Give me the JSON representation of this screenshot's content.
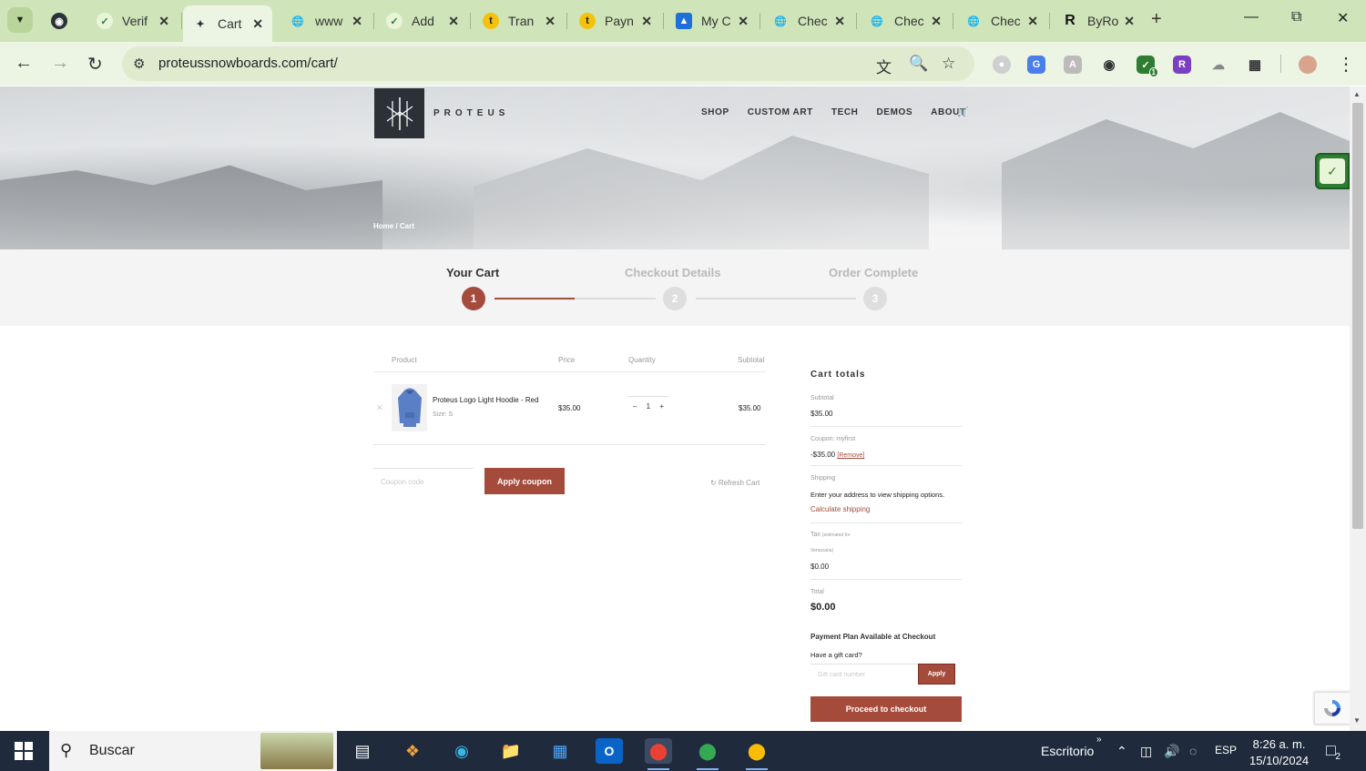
{
  "browser": {
    "tabs": [
      {
        "label": "Verif",
        "icon": "verify-icon",
        "color": "#2e7d32"
      },
      {
        "label": "Cart",
        "icon": "proteus-icon",
        "color": "#2b3137",
        "active": true
      },
      {
        "label": "www",
        "icon": "globe-icon",
        "color": "#333"
      },
      {
        "label": "Add",
        "icon": "verify-icon",
        "color": "#2e7d32"
      },
      {
        "label": "Tran",
        "icon": "t-icon",
        "color": "#f4c20d"
      },
      {
        "label": "Payn",
        "icon": "t-icon",
        "color": "#f4c20d"
      },
      {
        "label": "My C",
        "icon": "edge-icon",
        "color": "#1e6fd9"
      },
      {
        "label": "Chec",
        "icon": "globe-icon",
        "color": "#333"
      },
      {
        "label": "Chec",
        "icon": "globe-icon",
        "color": "#333"
      },
      {
        "label": "Chec",
        "icon": "globe-icon",
        "color": "#333"
      },
      {
        "label": "ByRo",
        "icon": "r-icon",
        "color": "#111"
      }
    ],
    "url": "proteussnowboards.com/cart/",
    "extension_badge": "1"
  },
  "site": {
    "logo_text": "PROTEUS",
    "nav": [
      "SHOP",
      "CUSTOM ART",
      "TECH",
      "DEMOS",
      "ABOUT"
    ],
    "breadcrumb": "Home  /  Cart"
  },
  "steps": [
    {
      "label": "Your Cart",
      "number": "1",
      "active": true
    },
    {
      "label": "Checkout Details",
      "number": "2",
      "active": false
    },
    {
      "label": "Order Complete",
      "number": "3",
      "active": false
    }
  ],
  "cart": {
    "headers": {
      "product": "Product",
      "price": "Price",
      "quantity": "Quantity",
      "subtotal": "Subtotal"
    },
    "item": {
      "name": "Proteus Logo Light Hoodie - Red",
      "meta": "Size: S",
      "price": "$35.00",
      "quantity": "1",
      "subtotal": "$35.00"
    },
    "coupon_placeholder": "Coupon code",
    "apply_coupon": "Apply coupon",
    "refresh": "Refresh Cart"
  },
  "totals": {
    "title": "Cart totals",
    "subtotal_label": "Subtotal",
    "subtotal_value": "$35.00",
    "coupon_label": "Coupon: myfirst",
    "coupon_value": "-$35.00",
    "coupon_remove": "[Remove]",
    "shipping_label": "Shipping",
    "shipping_text": "Enter your address to view shipping options.",
    "shipping_link": "Calculate shipping",
    "tax_label": "Tax",
    "tax_note": "(estimated for",
    "tax_country": "Venezuela)",
    "tax_value": "$0.00",
    "total_label": "Total",
    "total_value": "$0.00",
    "payment_plan": "Payment Plan Available at Checkout",
    "gift_label": "Have a gift card?",
    "gift_placeholder": "Gift card number",
    "gift_apply": "Apply",
    "checkout": "Proceed to checkout"
  },
  "taskbar": {
    "search": "Buscar",
    "desktop": "Escritorio",
    "lang": "ESP",
    "time": "8:26 a. m.",
    "date": "15/10/2024",
    "notif_count": "2"
  },
  "colors": {
    "accent": "#a44b3c",
    "tab_bar": "#cfe4b8",
    "toolbar": "#ecf4e4"
  }
}
